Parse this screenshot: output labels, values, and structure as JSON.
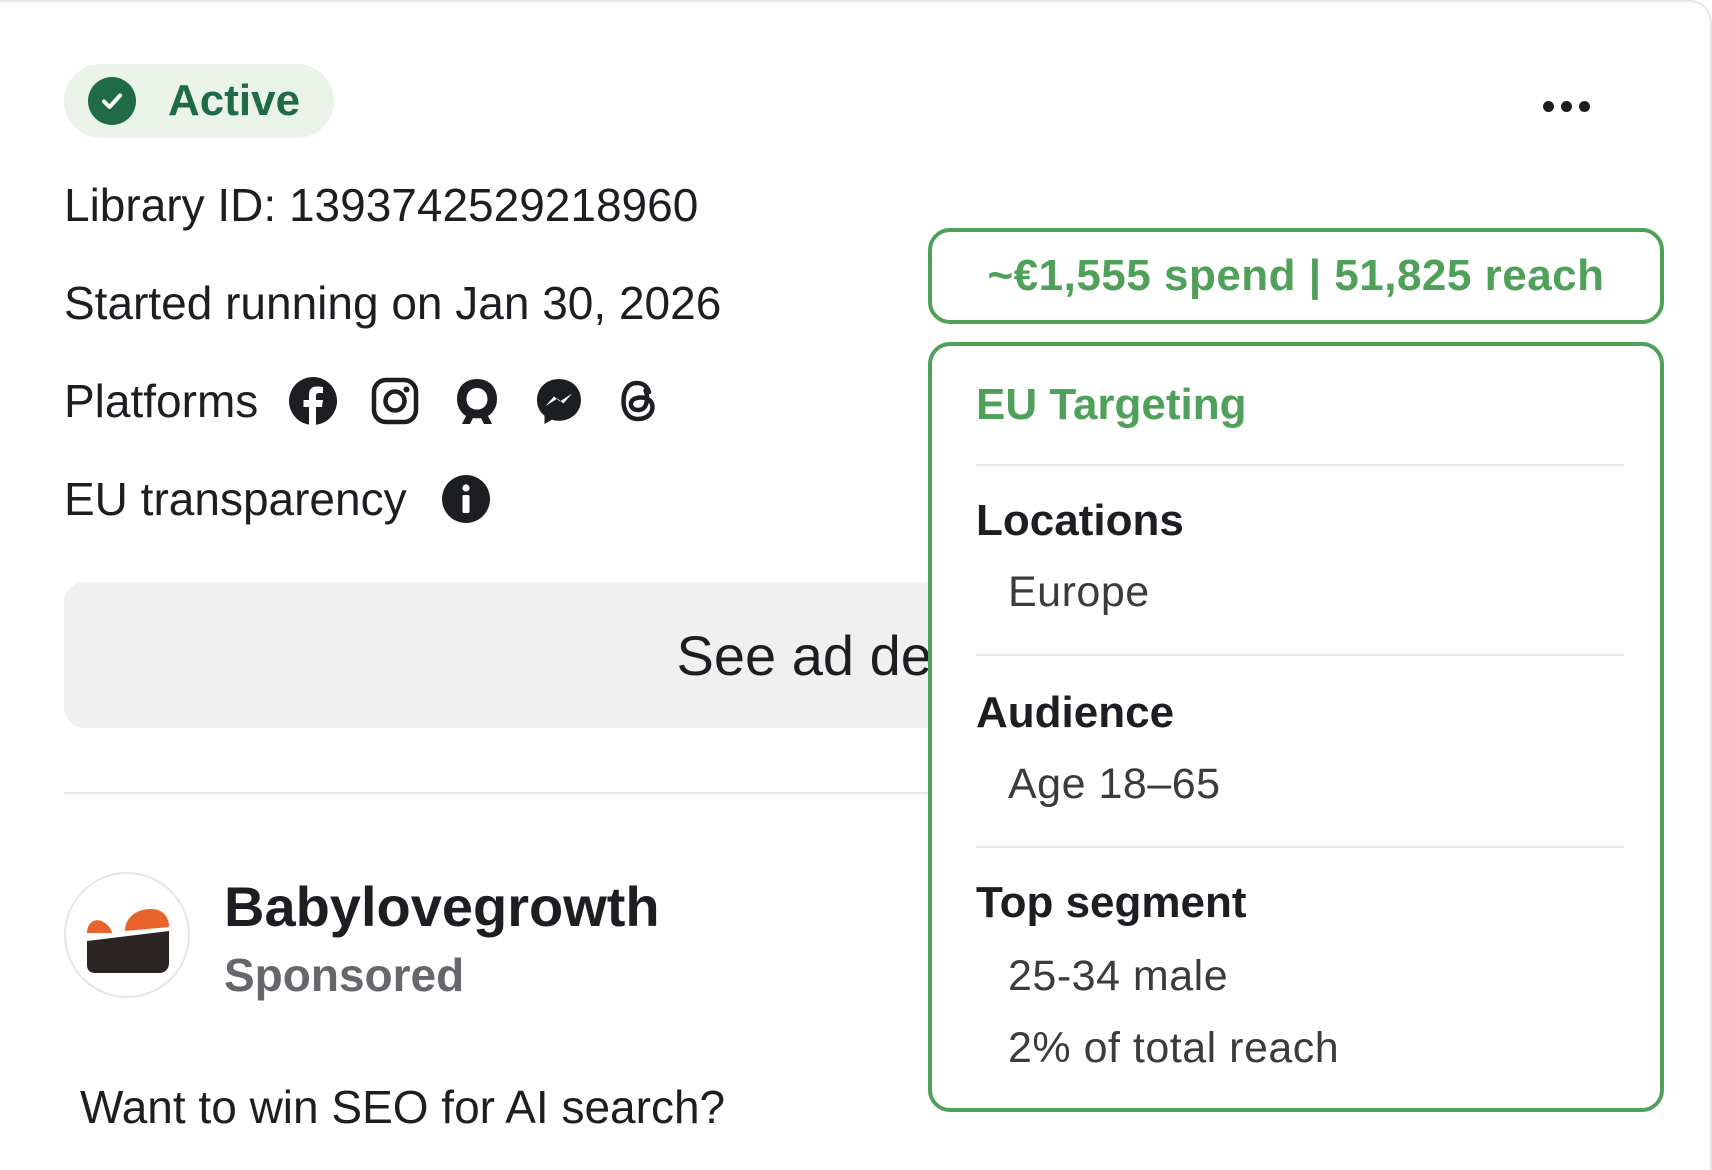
{
  "status": {
    "label": "Active",
    "color": "#1e6b45"
  },
  "ad": {
    "library_id": "Library ID: 1393742529218960",
    "started": "Started running on Jan 30, 2026",
    "platforms_label": "Platforms",
    "platforms": [
      "facebook-icon",
      "instagram-icon",
      "audience-network-icon",
      "messenger-icon",
      "threads-icon"
    ],
    "eu_transparency_label": "EU transparency",
    "see_details_label": "See ad details"
  },
  "advertiser": {
    "name": "Babylovegrowth",
    "sponsored": "Sponsored",
    "ad_text": "Want to win SEO for AI search?"
  },
  "overlay": {
    "accent": "#4fa058",
    "summary": "~€1,555 spend | 51,825 reach",
    "title": "EU Targeting",
    "locations_label": "Locations",
    "locations_value": "Europe",
    "audience_label": "Audience",
    "audience_value": "Age 18–65",
    "top_segment_label": "Top segment",
    "top_segment_value": "25-34 male",
    "top_segment_share": "2% of total reach"
  }
}
